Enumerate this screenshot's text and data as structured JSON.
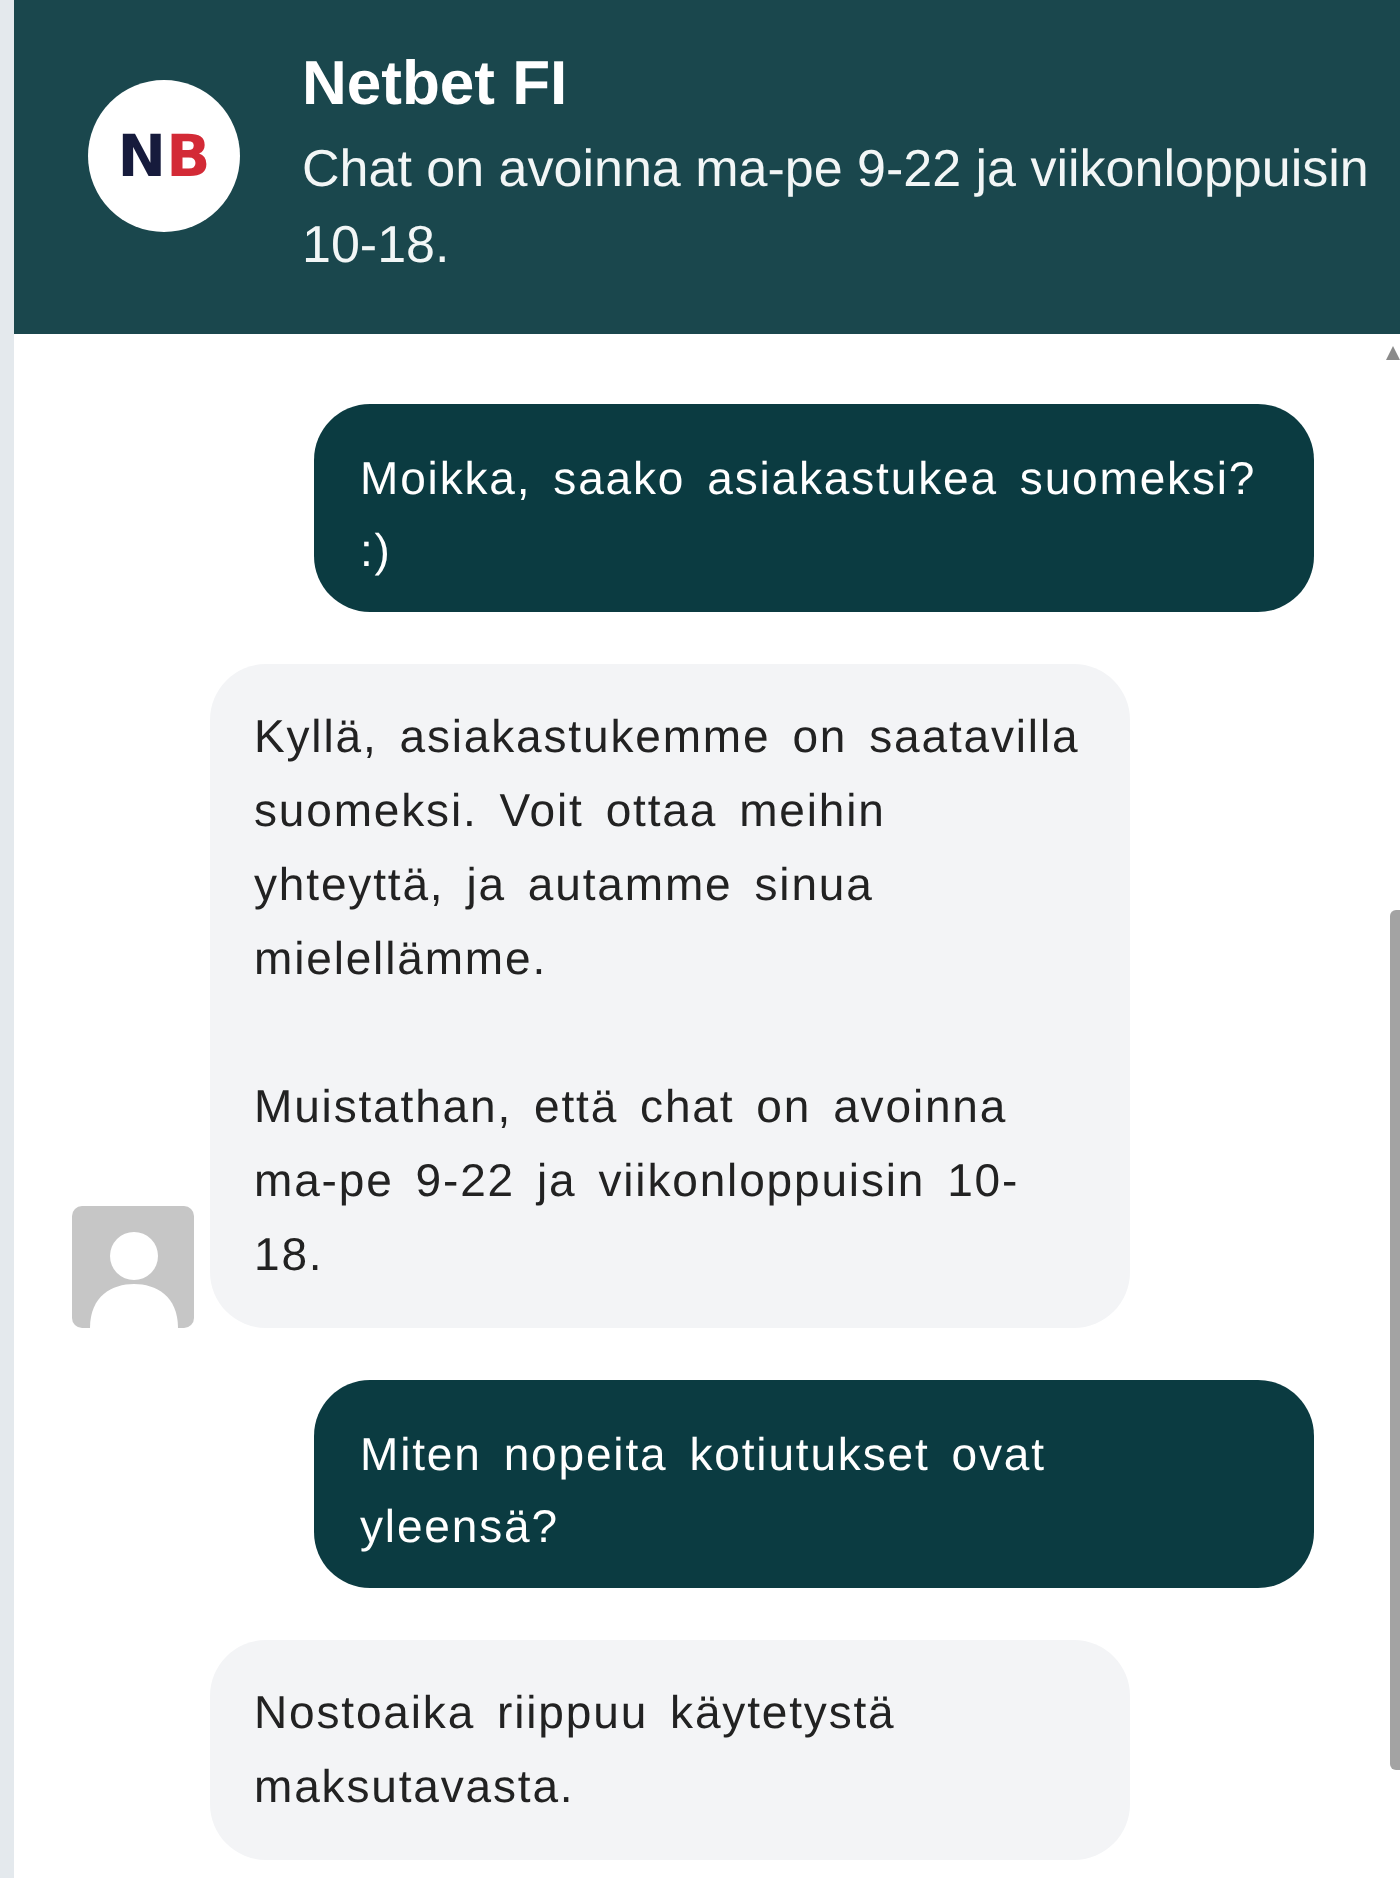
{
  "header": {
    "logo": {
      "letters": [
        {
          "text": "N",
          "color": "#161b3c"
        },
        {
          "text": "B",
          "color": "#d32a36"
        }
      ]
    },
    "title": "Netbet FI",
    "subtitle": "Chat on avoinna ma-pe 9-22 ja viikonloppuisin 10-18."
  },
  "messages": [
    {
      "kind": "outgoing",
      "paragraphs": [
        "Moikka, saako asiakastukea suomeksi? :)"
      ]
    },
    {
      "kind": "incoming",
      "avatar": true,
      "paragraphs": [
        "Kyllä, asiakastukemme on saatavilla suomeksi. Voit ottaa meihin yhteyttä, ja autamme sinua mielellämme.",
        "Muistathan, että chat on avoinna ma-pe 9-22 ja viikonloppuisin 10-18."
      ]
    },
    {
      "kind": "outgoing",
      "paragraphs": [
        "Miten nopeita kotiutukset ovat yleensä?"
      ]
    },
    {
      "kind": "incoming",
      "paragraphs": [
        "Nostoaika riippuu käytetystä maksutavasta."
      ]
    }
  ]
}
